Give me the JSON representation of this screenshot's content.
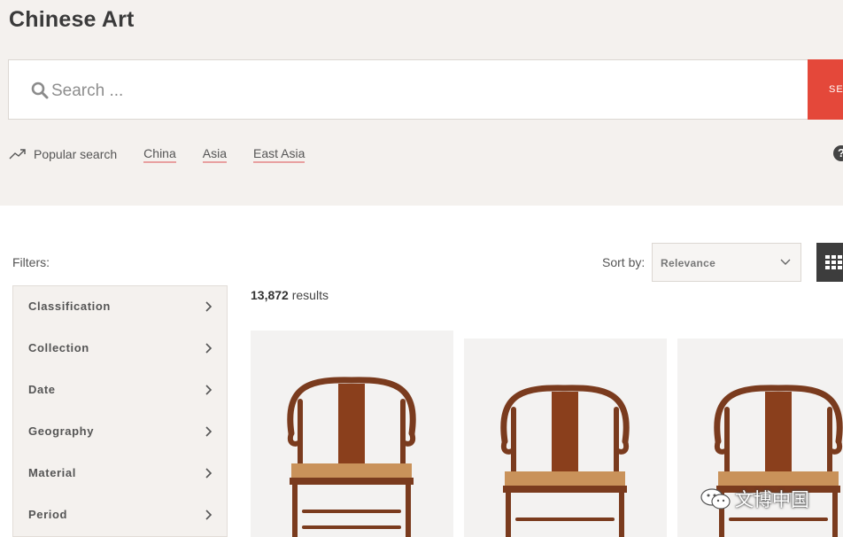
{
  "page_title": "Chinese Art",
  "search": {
    "placeholder": "Search ...",
    "button_label": "SEARCH"
  },
  "popular_search": {
    "label": "Popular search",
    "links": [
      "China",
      "Asia",
      "East Asia"
    ]
  },
  "filters": {
    "label": "Filters:",
    "items": [
      "Classification",
      "Collection",
      "Date",
      "Geography",
      "Material",
      "Period"
    ]
  },
  "sort": {
    "label": "Sort by:",
    "selected": "Relevance"
  },
  "results": {
    "count": "13,872",
    "suffix": " results"
  },
  "watermark": {
    "text": "文博中国"
  },
  "colors": {
    "accent": "#e4483a",
    "band": "#f4f1ee",
    "link_underline": "#e8a0a0"
  },
  "icons": [
    "search-icon",
    "trend-icon",
    "help-icon",
    "chevron-right-icon",
    "chevron-down-icon",
    "grid-view-icon",
    "wechat-icon"
  ]
}
